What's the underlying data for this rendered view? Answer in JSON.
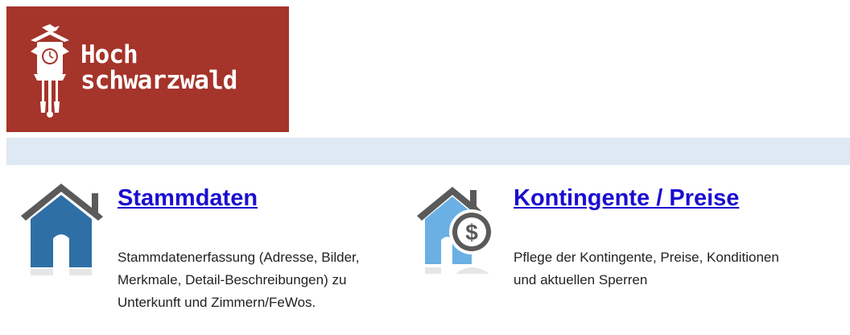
{
  "logo": {
    "line1": "Hoch",
    "line2": "schwarzwald",
    "background": "#a5342a"
  },
  "tiles": [
    {
      "icon": "house-icon",
      "title": "Stammdaten",
      "description": "Stammdatenerfassung (Adresse, Bilder, Merkmale, Detail-Beschreibungen) zu Unterkunft und Zimmern/FeWos."
    },
    {
      "icon": "house-dollar-icon",
      "title": "Kontingente / Preise",
      "description": "Pflege der Kontingente, Preise, Konditionen und aktuellen Sperren"
    }
  ],
  "colors": {
    "band": "#dfe9f4",
    "link": "#1a0dcf",
    "house_blue": "#2e6fa6",
    "house_light_blue": "#6ab0e4",
    "roof_gray": "#5a5a5a"
  }
}
